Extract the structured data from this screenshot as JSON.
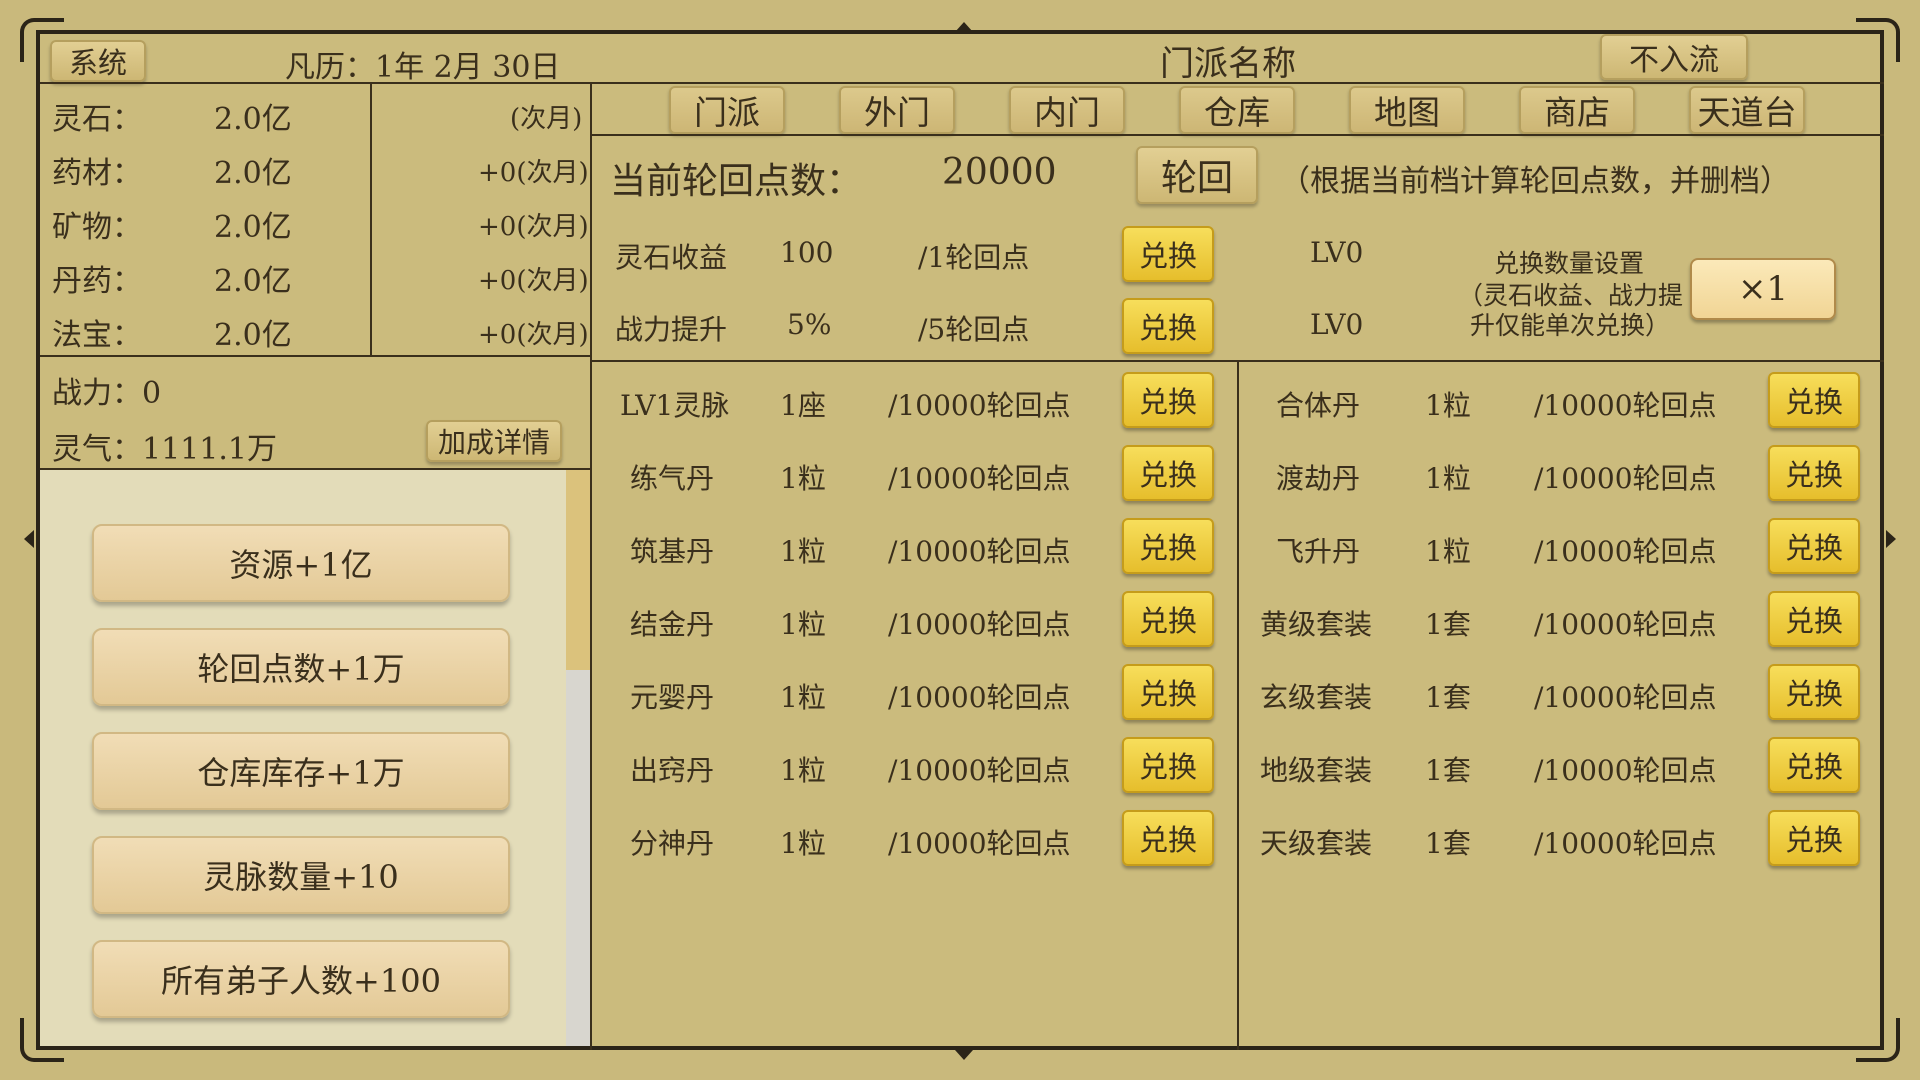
{
  "header": {
    "system_label": "系统",
    "date": "凡历：1年 2月 30日",
    "sect_name": "门派名称",
    "rank_label": "不入流"
  },
  "resources": [
    {
      "name": "灵石：",
      "value": "2.0亿",
      "change": "(次月)"
    },
    {
      "name": "药材：",
      "value": "2.0亿",
      "change": "+0(次月)"
    },
    {
      "name": "矿物：",
      "value": "2.0亿",
      "change": "+0(次月)"
    },
    {
      "name": "丹药：",
      "value": "2.0亿",
      "change": "+0(次月)"
    },
    {
      "name": "法宝：",
      "value": "2.0亿",
      "change": "+0(次月)"
    }
  ],
  "stats": {
    "power": "战力：0",
    "qi": "灵气：1111.1万",
    "bonus_button": "加成详情"
  },
  "cheats": [
    "资源+1亿",
    "轮回点数+1万",
    "仓库库存+1万",
    "灵脉数量+10",
    "所有弟子人数+100"
  ],
  "tabs": [
    "门派",
    "外门",
    "内门",
    "仓库",
    "地图",
    "商店",
    "天道台"
  ],
  "reincarnation": {
    "label": "当前轮回点数：",
    "points": "20000",
    "button": "轮回",
    "note": "（根据当前档计算轮回点数，并删档）"
  },
  "upgrades": [
    {
      "name": "灵石收益",
      "amount": "100",
      "cost": "/1轮回点",
      "button": "兑换",
      "level": "LV0"
    },
    {
      "name": "战力提升",
      "amount": "5%",
      "cost": "/5轮回点",
      "button": "兑换",
      "level": "LV0"
    }
  ],
  "exchange_setting": {
    "line1": "兑换数量设置",
    "line2": "（灵石收益、战力提",
    "line3": "升仅能单次兑换）",
    "multiplier": "×1"
  },
  "left_items": [
    {
      "name": "LV1灵脉",
      "qty": "1座",
      "cost": "/10000轮回点",
      "button": "兑换"
    },
    {
      "name": "练气丹",
      "qty": "1粒",
      "cost": "/10000轮回点",
      "button": "兑换"
    },
    {
      "name": "筑基丹",
      "qty": "1粒",
      "cost": "/10000轮回点",
      "button": "兑换"
    },
    {
      "name": "结金丹",
      "qty": "1粒",
      "cost": "/10000轮回点",
      "button": "兑换"
    },
    {
      "name": "元婴丹",
      "qty": "1粒",
      "cost": "/10000轮回点",
      "button": "兑换"
    },
    {
      "name": "出窍丹",
      "qty": "1粒",
      "cost": "/10000轮回点",
      "button": "兑换"
    },
    {
      "name": "分神丹",
      "qty": "1粒",
      "cost": "/10000轮回点",
      "button": "兑换"
    }
  ],
  "right_items": [
    {
      "name": "合体丹",
      "qty": "1粒",
      "cost": "/10000轮回点",
      "button": "兑换"
    },
    {
      "name": "渡劫丹",
      "qty": "1粒",
      "cost": "/10000轮回点",
      "button": "兑换"
    },
    {
      "name": "飞升丹",
      "qty": "1粒",
      "cost": "/10000轮回点",
      "button": "兑换"
    },
    {
      "name": "黄级套装",
      "qty": "1套",
      "cost": "/10000轮回点",
      "button": "兑换"
    },
    {
      "name": "玄级套装",
      "qty": "1套",
      "cost": "/10000轮回点",
      "button": "兑换"
    },
    {
      "name": "地级套装",
      "qty": "1套",
      "cost": "/10000轮回点",
      "button": "兑换"
    },
    {
      "name": "天级套装",
      "qty": "1套",
      "cost": "/10000轮回点",
      "button": "兑换"
    }
  ],
  "colors": {
    "background": "#c9b97c",
    "border": "#2b2418",
    "exchange_button": "#f0cf3e",
    "cheat_panel": "#e3dcb9"
  }
}
